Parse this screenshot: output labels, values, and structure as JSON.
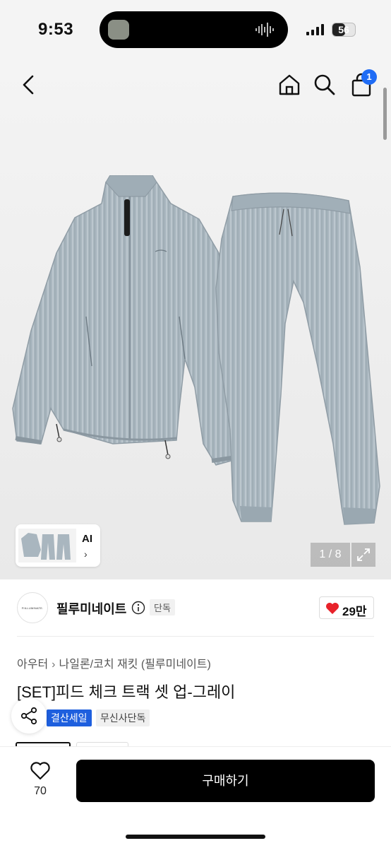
{
  "status_bar": {
    "time": "9:53",
    "battery": "56",
    "battery_level": 0.56
  },
  "header": {
    "cart_count": "1"
  },
  "gallery": {
    "ai_label": "AI",
    "ai_chevron": "›",
    "page_counter": "1 / 8"
  },
  "brand": {
    "logo_text": "FIILLUMINATE.",
    "name": "필루미네이트",
    "exclusive_tag": "단독",
    "like_count": "29만"
  },
  "breadcrumb": [
    "아우터",
    "나일론/코치 재킷 (필루미네이트)"
  ],
  "product": {
    "title": "[SET]피드 체크 트랙 셋 업-그레이"
  },
  "tags": [
    "결산세일",
    "무신사단독"
  ],
  "bottom": {
    "wish_count": "70",
    "buy_label": "구매하기"
  },
  "colors": {
    "accent_blue": "#1e5fde",
    "badge_blue": "#1f6cf5",
    "heart_red": "#e8222a",
    "garment_gray": "#a9b6bf"
  },
  "icons": [
    "back-icon",
    "home-icon",
    "search-icon",
    "cart-icon",
    "expand-icon",
    "info-icon",
    "heart-icon",
    "share-icon",
    "heart-outline-icon"
  ]
}
